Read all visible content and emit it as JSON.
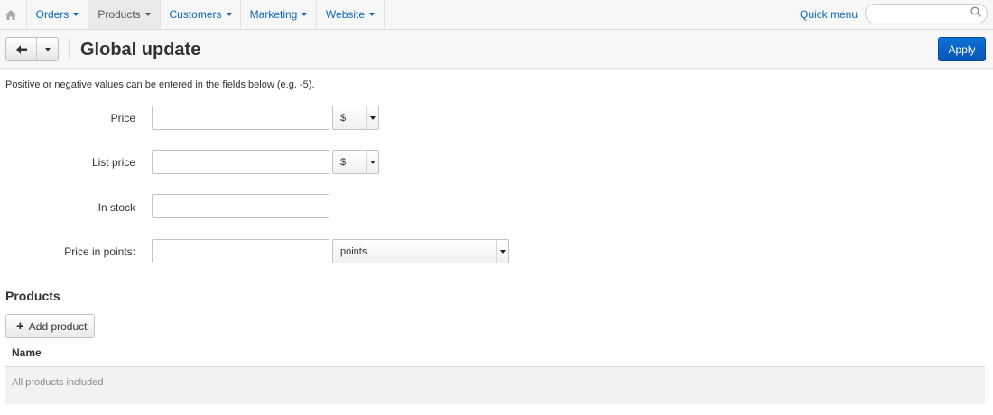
{
  "nav": {
    "items": [
      {
        "label": "Orders"
      },
      {
        "label": "Products"
      },
      {
        "label": "Customers"
      },
      {
        "label": "Marketing"
      },
      {
        "label": "Website"
      }
    ],
    "quick_menu": "Quick menu",
    "search_value": ""
  },
  "header": {
    "title": "Global update",
    "apply_label": "Apply"
  },
  "form": {
    "hint": "Positive or negative values can be entered in the fields below (e.g. -5).",
    "price": {
      "label": "Price",
      "value": "",
      "unit": "$"
    },
    "list_price": {
      "label": "List price",
      "value": "",
      "unit": "$"
    },
    "in_stock": {
      "label": "In stock",
      "value": ""
    },
    "price_in_points": {
      "label": "Price in points:",
      "value": "",
      "unit": "points"
    }
  },
  "products": {
    "title": "Products",
    "add_label": "Add product",
    "column_name": "Name",
    "empty_text": "All products included"
  },
  "colors": {
    "link": "#0b67b8",
    "primary": "#0a63c6"
  }
}
